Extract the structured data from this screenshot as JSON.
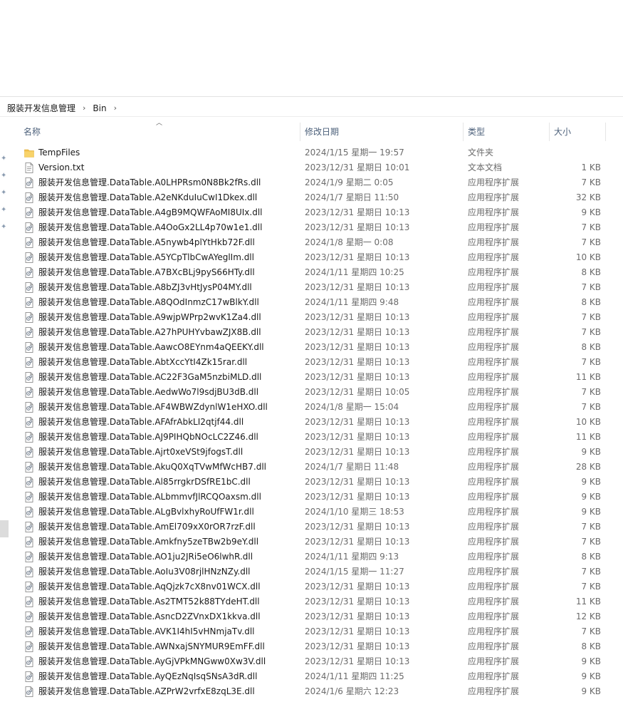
{
  "breadcrumb": {
    "parent": "服装开发信息管理",
    "current": "Bin"
  },
  "columns": {
    "name": "名称",
    "date": "修改日期",
    "type": "类型",
    "size": "大小"
  },
  "files": [
    {
      "name": "TempFiles",
      "date": "2024/1/15 星期一 19:57",
      "type": "文件夹",
      "size": "",
      "icon": "folder-icon"
    },
    {
      "name": "Version.txt",
      "date": "2023/12/31 星期日 10:01",
      "type": "文本文档",
      "size": "1 KB",
      "icon": "text-file-icon"
    },
    {
      "name": "服装开发信息管理.DataTable.A0LHPRsm0N8Bk2fRs.dll",
      "date": "2024/1/9 星期二 0:05",
      "type": "应用程序扩展",
      "size": "7 KB",
      "icon": "dll-file-icon"
    },
    {
      "name": "服装开发信息管理.DataTable.A2eNKduIuCwI1Dkex.dll",
      "date": "2024/1/7 星期日 11:50",
      "type": "应用程序扩展",
      "size": "32 KB",
      "icon": "dll-file-icon"
    },
    {
      "name": "服装开发信息管理.DataTable.A4gB9MQWFAoMI8UIx.dll",
      "date": "2023/12/31 星期日 10:13",
      "type": "应用程序扩展",
      "size": "9 KB",
      "icon": "dll-file-icon"
    },
    {
      "name": "服装开发信息管理.DataTable.A4OoGx2LL4p70w1e1.dll",
      "date": "2023/12/31 星期日 10:13",
      "type": "应用程序扩展",
      "size": "7 KB",
      "icon": "dll-file-icon"
    },
    {
      "name": "服装开发信息管理.DataTable.A5nywb4plYtHkb72F.dll",
      "date": "2024/1/8 星期一 0:08",
      "type": "应用程序扩展",
      "size": "7 KB",
      "icon": "dll-file-icon"
    },
    {
      "name": "服装开发信息管理.DataTable.A5YCpTlbCwAYeglIm.dll",
      "date": "2023/12/31 星期日 10:13",
      "type": "应用程序扩展",
      "size": "10 KB",
      "icon": "dll-file-icon"
    },
    {
      "name": "服装开发信息管理.DataTable.A7BXcBLj9pyS66HTy.dll",
      "date": "2024/1/11 星期四 10:25",
      "type": "应用程序扩展",
      "size": "8 KB",
      "icon": "dll-file-icon"
    },
    {
      "name": "服装开发信息管理.DataTable.A8bZJ3vHtJysP04MY.dll",
      "date": "2023/12/31 星期日 10:13",
      "type": "应用程序扩展",
      "size": "7 KB",
      "icon": "dll-file-icon"
    },
    {
      "name": "服装开发信息管理.DataTable.A8QOdInmzC17wBlkY.dll",
      "date": "2024/1/11 星期四 9:48",
      "type": "应用程序扩展",
      "size": "8 KB",
      "icon": "dll-file-icon"
    },
    {
      "name": "服装开发信息管理.DataTable.A9wjpWPrp2wvK1Za4.dll",
      "date": "2023/12/31 星期日 10:13",
      "type": "应用程序扩展",
      "size": "7 KB",
      "icon": "dll-file-icon"
    },
    {
      "name": "服装开发信息管理.DataTable.A27hPUHYvbawZJX8B.dll",
      "date": "2023/12/31 星期日 10:13",
      "type": "应用程序扩展",
      "size": "7 KB",
      "icon": "dll-file-icon"
    },
    {
      "name": "服装开发信息管理.DataTable.AawcO8EYnm4aQEEKY.dll",
      "date": "2023/12/31 星期日 10:13",
      "type": "应用程序扩展",
      "size": "8 KB",
      "icon": "dll-file-icon"
    },
    {
      "name": "服装开发信息管理.DataTable.AbtXccYtI4Zk15rar.dll",
      "date": "2023/12/31 星期日 10:13",
      "type": "应用程序扩展",
      "size": "7 KB",
      "icon": "dll-file-icon"
    },
    {
      "name": "服装开发信息管理.DataTable.AC22F3GaM5nzbiMLD.dll",
      "date": "2023/12/31 星期日 10:13",
      "type": "应用程序扩展",
      "size": "11 KB",
      "icon": "dll-file-icon"
    },
    {
      "name": "服装开发信息管理.DataTable.AedwWo7l9sdjBU3dB.dll",
      "date": "2023/12/31 星期日 10:05",
      "type": "应用程序扩展",
      "size": "7 KB",
      "icon": "dll-file-icon"
    },
    {
      "name": "服装开发信息管理.DataTable.AF4WBWZdynlW1eHXO.dll",
      "date": "2024/1/8 星期一 15:04",
      "type": "应用程序扩展",
      "size": "7 KB",
      "icon": "dll-file-icon"
    },
    {
      "name": "服装开发信息管理.DataTable.AFAfrAbkLI2qtjf44.dll",
      "date": "2023/12/31 星期日 10:13",
      "type": "应用程序扩展",
      "size": "10 KB",
      "icon": "dll-file-icon"
    },
    {
      "name": "服装开发信息管理.DataTable.AJ9PIHQbNOcLC2Z46.dll",
      "date": "2023/12/31 星期日 10:13",
      "type": "应用程序扩展",
      "size": "11 KB",
      "icon": "dll-file-icon"
    },
    {
      "name": "服装开发信息管理.DataTable.Ajrt0xeVSt9jfogsT.dll",
      "date": "2023/12/31 星期日 10:13",
      "type": "应用程序扩展",
      "size": "9 KB",
      "icon": "dll-file-icon"
    },
    {
      "name": "服装开发信息管理.DataTable.AkuQ0XqTVwMfWcHB7.dll",
      "date": "2024/1/7 星期日 11:48",
      "type": "应用程序扩展",
      "size": "28 KB",
      "icon": "dll-file-icon"
    },
    {
      "name": "服装开发信息管理.DataTable.Al85rrgkrDSfRE1bC.dll",
      "date": "2023/12/31 星期日 10:13",
      "type": "应用程序扩展",
      "size": "9 KB",
      "icon": "dll-file-icon"
    },
    {
      "name": "服装开发信息管理.DataTable.ALbmmvfJlRCQOaxsm.dll",
      "date": "2023/12/31 星期日 10:13",
      "type": "应用程序扩展",
      "size": "9 KB",
      "icon": "dll-file-icon"
    },
    {
      "name": "服装开发信息管理.DataTable.ALgBvlxhyRoUfFW1r.dll",
      "date": "2024/1/10 星期三 18:53",
      "type": "应用程序扩展",
      "size": "9 KB",
      "icon": "dll-file-icon"
    },
    {
      "name": "服装开发信息管理.DataTable.AmEl709xX0rOR7rzF.dll",
      "date": "2023/12/31 星期日 10:13",
      "type": "应用程序扩展",
      "size": "7 KB",
      "icon": "dll-file-icon"
    },
    {
      "name": "服装开发信息管理.DataTable.Amkfny5zeTBw2b9eY.dll",
      "date": "2023/12/31 星期日 10:13",
      "type": "应用程序扩展",
      "size": "7 KB",
      "icon": "dll-file-icon"
    },
    {
      "name": "服装开发信息管理.DataTable.AO1ju2JRi5eO6lwhR.dll",
      "date": "2024/1/11 星期四 9:13",
      "type": "应用程序扩展",
      "size": "8 KB",
      "icon": "dll-file-icon"
    },
    {
      "name": "服装开发信息管理.DataTable.AoIu3V08rjlHNzNZy.dll",
      "date": "2024/1/15 星期一 11:27",
      "type": "应用程序扩展",
      "size": "7 KB",
      "icon": "dll-file-icon"
    },
    {
      "name": "服装开发信息管理.DataTable.AqQjzk7cX8nv01WCX.dll",
      "date": "2023/12/31 星期日 10:13",
      "type": "应用程序扩展",
      "size": "7 KB",
      "icon": "dll-file-icon"
    },
    {
      "name": "服装开发信息管理.DataTable.As2TMT52k88TYdeHT.dll",
      "date": "2023/12/31 星期日 10:13",
      "type": "应用程序扩展",
      "size": "11 KB",
      "icon": "dll-file-icon"
    },
    {
      "name": "服装开发信息管理.DataTable.AsncD2ZVnxDX1kkva.dll",
      "date": "2023/12/31 星期日 10:13",
      "type": "应用程序扩展",
      "size": "12 KB",
      "icon": "dll-file-icon"
    },
    {
      "name": "服装开发信息管理.DataTable.AVK1I4hI5vHNmjaTv.dll",
      "date": "2023/12/31 星期日 10:13",
      "type": "应用程序扩展",
      "size": "7 KB",
      "icon": "dll-file-icon"
    },
    {
      "name": "服装开发信息管理.DataTable.AWNxajSNYMUR9EmFF.dll",
      "date": "2023/12/31 星期日 10:13",
      "type": "应用程序扩展",
      "size": "8 KB",
      "icon": "dll-file-icon"
    },
    {
      "name": "服装开发信息管理.DataTable.AyGjVPkMNGww0Xw3V.dll",
      "date": "2023/12/31 星期日 10:13",
      "type": "应用程序扩展",
      "size": "9 KB",
      "icon": "dll-file-icon"
    },
    {
      "name": "服装开发信息管理.DataTable.AyQEzNqIsqSNsA3dR.dll",
      "date": "2024/1/11 星期四 11:25",
      "type": "应用程序扩展",
      "size": "9 KB",
      "icon": "dll-file-icon"
    },
    {
      "name": "服装开发信息管理.DataTable.AZPrW2vrfxE8zqL3E.dll",
      "date": "2024/1/6 星期六 12:23",
      "type": "应用程序扩展",
      "size": "9 KB",
      "icon": "dll-file-icon"
    }
  ],
  "colors": {
    "header_text": "#4c607a",
    "meta_text": "#6b6b6b",
    "folder": "#f2c14e"
  }
}
